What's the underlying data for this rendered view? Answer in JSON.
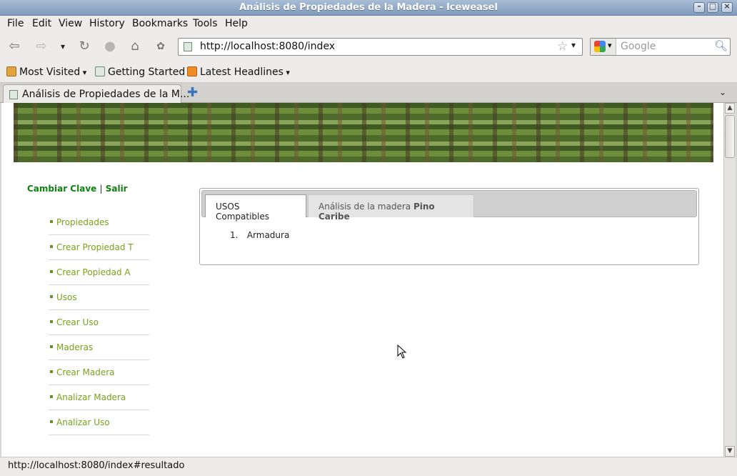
{
  "window": {
    "title": "Análisis de Propiedades de la Madera - Iceweasel",
    "controls": [
      "minimize",
      "maximize",
      "close"
    ]
  },
  "menubar": {
    "items": [
      {
        "label": "File"
      },
      {
        "label": "Edit"
      },
      {
        "label": "View"
      },
      {
        "label": "History"
      },
      {
        "label": "Bookmarks"
      },
      {
        "label": "Tools"
      },
      {
        "label": "Help"
      }
    ]
  },
  "navigation": {
    "icons": [
      "back-icon",
      "forward-icon",
      "history-dropdown-icon",
      "reload-icon",
      "stop-icon",
      "home-icon",
      "extension-icon"
    ],
    "url": "http://localhost:8080/index",
    "search_placeholder": "Google"
  },
  "bookmarks": {
    "items": [
      {
        "label": "Most Visited",
        "icon": "folder-icon",
        "dropdown": true
      },
      {
        "label": "Getting Started",
        "icon": "page-icon",
        "dropdown": false
      },
      {
        "label": "Latest Headlines",
        "icon": "rss-icon",
        "dropdown": true
      }
    ]
  },
  "tabs": {
    "active_label": "Análisis de Propiedades de la M..."
  },
  "page": {
    "account": {
      "change_password": "Cambiar Clave",
      "separator": "|",
      "logout": "Salir"
    },
    "sidebar": {
      "items": [
        {
          "label": "Propiedades"
        },
        {
          "label": "Crear Propiedad T"
        },
        {
          "label": "Crear Popiedad A"
        },
        {
          "label": "Usos"
        },
        {
          "label": "Crear Uso"
        },
        {
          "label": "Maderas"
        },
        {
          "label": "Crear Madera"
        },
        {
          "label": "Analizar Madera"
        },
        {
          "label": "Analizar Uso"
        }
      ]
    },
    "panel": {
      "tab_active": "USOS Compatibles",
      "tab_other_prefix": "Análisis de la madera",
      "tab_other_bold": "Pino Caribe",
      "list": [
        {
          "number": "1.",
          "label": "Armadura"
        }
      ]
    }
  },
  "statusbar": {
    "text": "http://localhost:8080/index#resultado"
  }
}
